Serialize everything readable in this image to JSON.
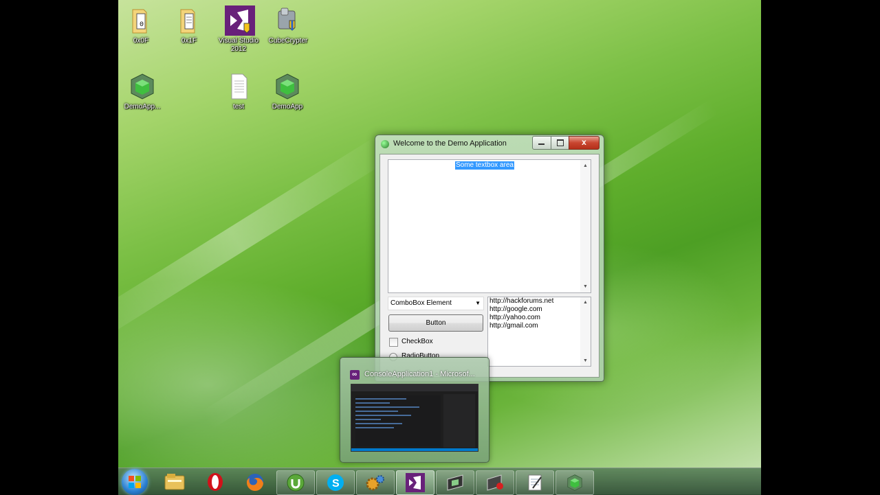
{
  "desktop": {
    "icons": [
      {
        "label": "0x0F",
        "icon": "folder-icon"
      },
      {
        "label": "0x1F",
        "icon": "folder-icon"
      },
      {
        "label": "Visual Studio 2012",
        "icon": "visual-studio-icon"
      },
      {
        "label": "CubeCrypter",
        "icon": "cubecrypter-icon"
      },
      {
        "label": "DemoApp...",
        "icon": "green-cube-icon"
      },
      {
        "label": "test",
        "icon": "text-file-icon"
      },
      {
        "label": "DemoApp",
        "icon": "green-cube-icon"
      }
    ]
  },
  "window": {
    "title": "Welcome to the Demo Application",
    "close_glyph": "x",
    "textbox": {
      "selected_text": "Some textbox area"
    },
    "combobox": {
      "value": "ComboBox Element"
    },
    "button_label": "Button",
    "checkbox": {
      "label": "CheckBox",
      "checked": false
    },
    "radio": {
      "label": "RadioButton",
      "checked": false
    },
    "listbox": {
      "items": [
        "http://hackforums.net",
        "http://google.com",
        "http://yahoo.com",
        "http://gmail.com"
      ]
    }
  },
  "taskbar_preview": {
    "title": "ConsoleApplication1 - Microsof..."
  },
  "taskbar": {
    "items": [
      {
        "icon": "windows-explorer-icon",
        "running": false
      },
      {
        "icon": "opera-icon",
        "running": false
      },
      {
        "icon": "firefox-icon",
        "running": false
      },
      {
        "icon": "utorrent-icon",
        "running": true
      },
      {
        "icon": "skype-icon",
        "running": true
      },
      {
        "icon": "gears-icon",
        "running": true
      },
      {
        "icon": "visual-studio-icon",
        "running": true,
        "active": true
      },
      {
        "icon": "terminal-icon",
        "running": true
      },
      {
        "icon": "recorder-icon",
        "running": true
      },
      {
        "icon": "notepad-icon",
        "running": true
      },
      {
        "icon": "green-cube-icon",
        "running": true
      }
    ]
  },
  "colors": {
    "vs_purple": "#68217a",
    "selection_blue": "#3399ff",
    "close_red": "#c8452f"
  }
}
